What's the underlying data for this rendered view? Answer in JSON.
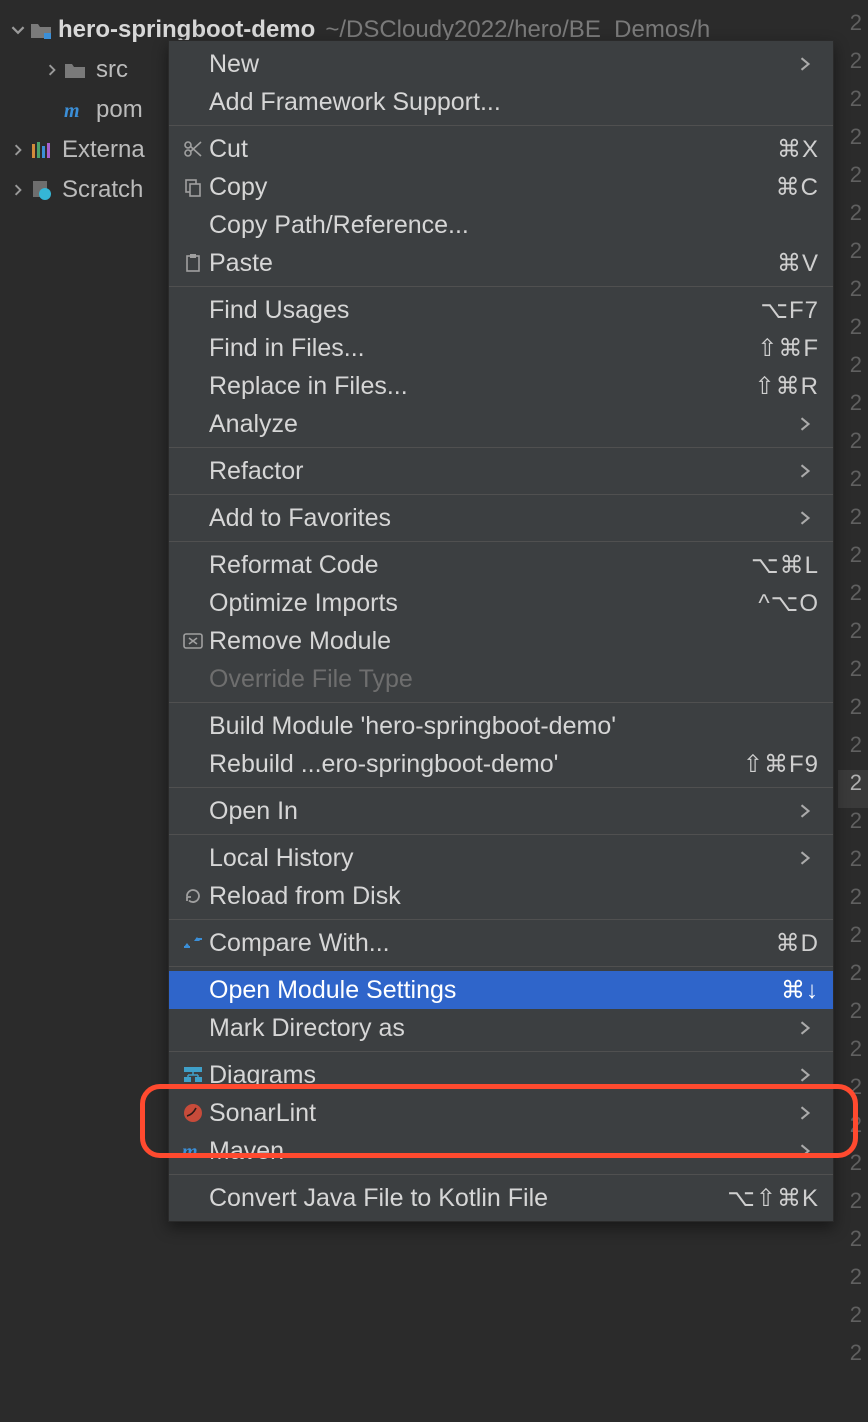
{
  "tree": {
    "project": {
      "name": "hero-springboot-demo",
      "path": "~/DSCloudy2022/hero/BE_Demos/h"
    },
    "items": [
      {
        "label": "src"
      },
      {
        "label": "pom"
      },
      {
        "label": "Externa"
      },
      {
        "label": "Scratch"
      }
    ]
  },
  "gutter": [
    "2",
    "2",
    "2",
    "2",
    "2",
    "2",
    "2",
    "2",
    "2",
    "2",
    "2",
    "2",
    "2",
    "2",
    "2",
    "2",
    "2",
    "2",
    "2",
    "2",
    "2",
    "2",
    "2",
    "2",
    "2",
    "2",
    "2",
    "2",
    "2",
    "2",
    "2",
    "2",
    "2",
    "2",
    "2",
    "2"
  ],
  "gutter_highlight_index": 20,
  "menu": {
    "groups": [
      [
        {
          "label": "New",
          "sub": true
        },
        {
          "label": "Add Framework Support..."
        }
      ],
      [
        {
          "label": "Cut",
          "shortcut": "⌘X",
          "icon": "scissors"
        },
        {
          "label": "Copy",
          "shortcut": "⌘C",
          "icon": "copy"
        },
        {
          "label": "Copy Path/Reference..."
        },
        {
          "label": "Paste",
          "shortcut": "⌘V",
          "icon": "clipboard"
        }
      ],
      [
        {
          "label": "Find Usages",
          "shortcut": "⌥F7"
        },
        {
          "label": "Find in Files...",
          "shortcut": "⇧⌘F"
        },
        {
          "label": "Replace in Files...",
          "shortcut": "⇧⌘R"
        },
        {
          "label": "Analyze",
          "sub": true
        }
      ],
      [
        {
          "label": "Refactor",
          "sub": true
        }
      ],
      [
        {
          "label": "Add to Favorites",
          "sub": true
        }
      ],
      [
        {
          "label": "Reformat Code",
          "shortcut": "⌥⌘L"
        },
        {
          "label": "Optimize Imports",
          "shortcut": "^⌥O"
        },
        {
          "label": "Remove Module",
          "icon": "delete-box"
        },
        {
          "label": "Override File Type",
          "disabled": true
        }
      ],
      [
        {
          "label": "Build Module 'hero-springboot-demo'"
        },
        {
          "label": "Rebuild ...ero-springboot-demo'",
          "shortcut": "⇧⌘F9"
        }
      ],
      [
        {
          "label": "Open In",
          "sub": true
        }
      ],
      [
        {
          "label": "Local History",
          "sub": true
        },
        {
          "label": "Reload from Disk",
          "icon": "reload"
        }
      ],
      [
        {
          "label": "Compare With...",
          "shortcut": "⌘D",
          "icon": "compare"
        }
      ],
      [
        {
          "label": "Open Module Settings",
          "shortcut": "⌘↓",
          "highlight": true
        },
        {
          "label": "Mark Directory as",
          "sub": true
        }
      ],
      [
        {
          "label": "Diagrams",
          "sub": true,
          "icon": "diagram"
        },
        {
          "label": "SonarLint",
          "sub": true,
          "icon": "sonar"
        },
        {
          "label": "Maven",
          "sub": true,
          "icon": "maven"
        }
      ],
      [
        {
          "label": "Convert Java File to Kotlin File",
          "shortcut": "⌥⇧⌘K"
        }
      ]
    ]
  }
}
